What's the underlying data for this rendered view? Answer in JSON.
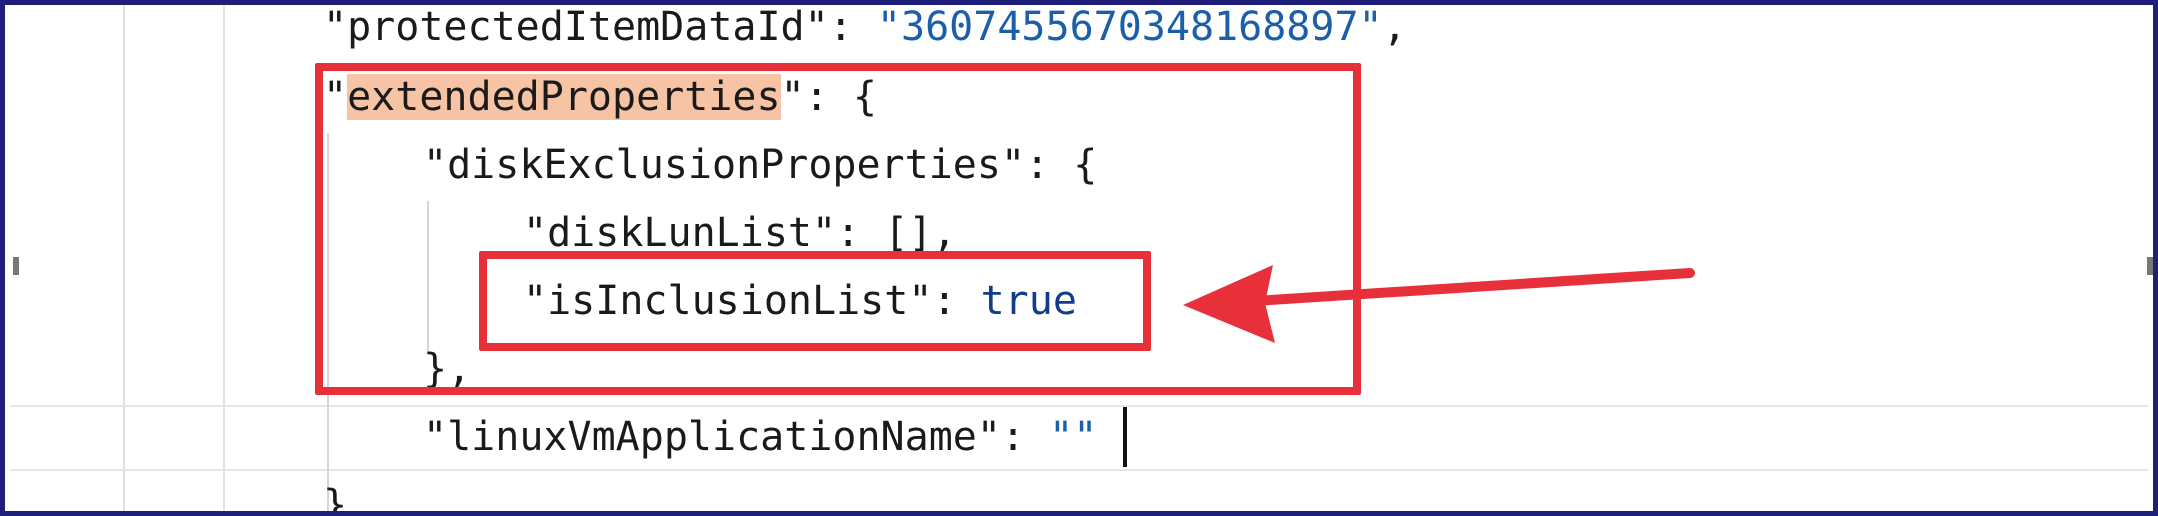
{
  "editor": {
    "lines": [
      {
        "key": "\"protectedItemDataId\"",
        "sep": ": ",
        "value": "\"3607455670348168897\"",
        "trail": ","
      },
      {
        "key_quote_open": "\"",
        "key_text": "extendedProperties",
        "key_quote_close": "\"",
        "sep": ": ",
        "brace": "{"
      },
      {
        "key": "\"diskExclusionProperties\"",
        "sep": ": ",
        "brace": "{"
      },
      {
        "key": "\"diskLunList\"",
        "sep": ": ",
        "value": "[],"
      },
      {
        "key": "\"isInclusionList\"",
        "sep": ": ",
        "value": "true"
      },
      {
        "brace": "},"
      },
      {
        "key": "\"linuxVmApplicationName\"",
        "sep": ": ",
        "value": "\"\""
      },
      {
        "brace": "},"
      }
    ]
  },
  "annotations": {
    "box_color": "#e8303a",
    "arrow_color": "#e8303a"
  },
  "theme": {
    "string_color": "#1a5fa8",
    "keyword_color": "#0f3d8c",
    "bracket_highlight": "#f6c3a4",
    "frame_border": "#1f1f7a"
  }
}
